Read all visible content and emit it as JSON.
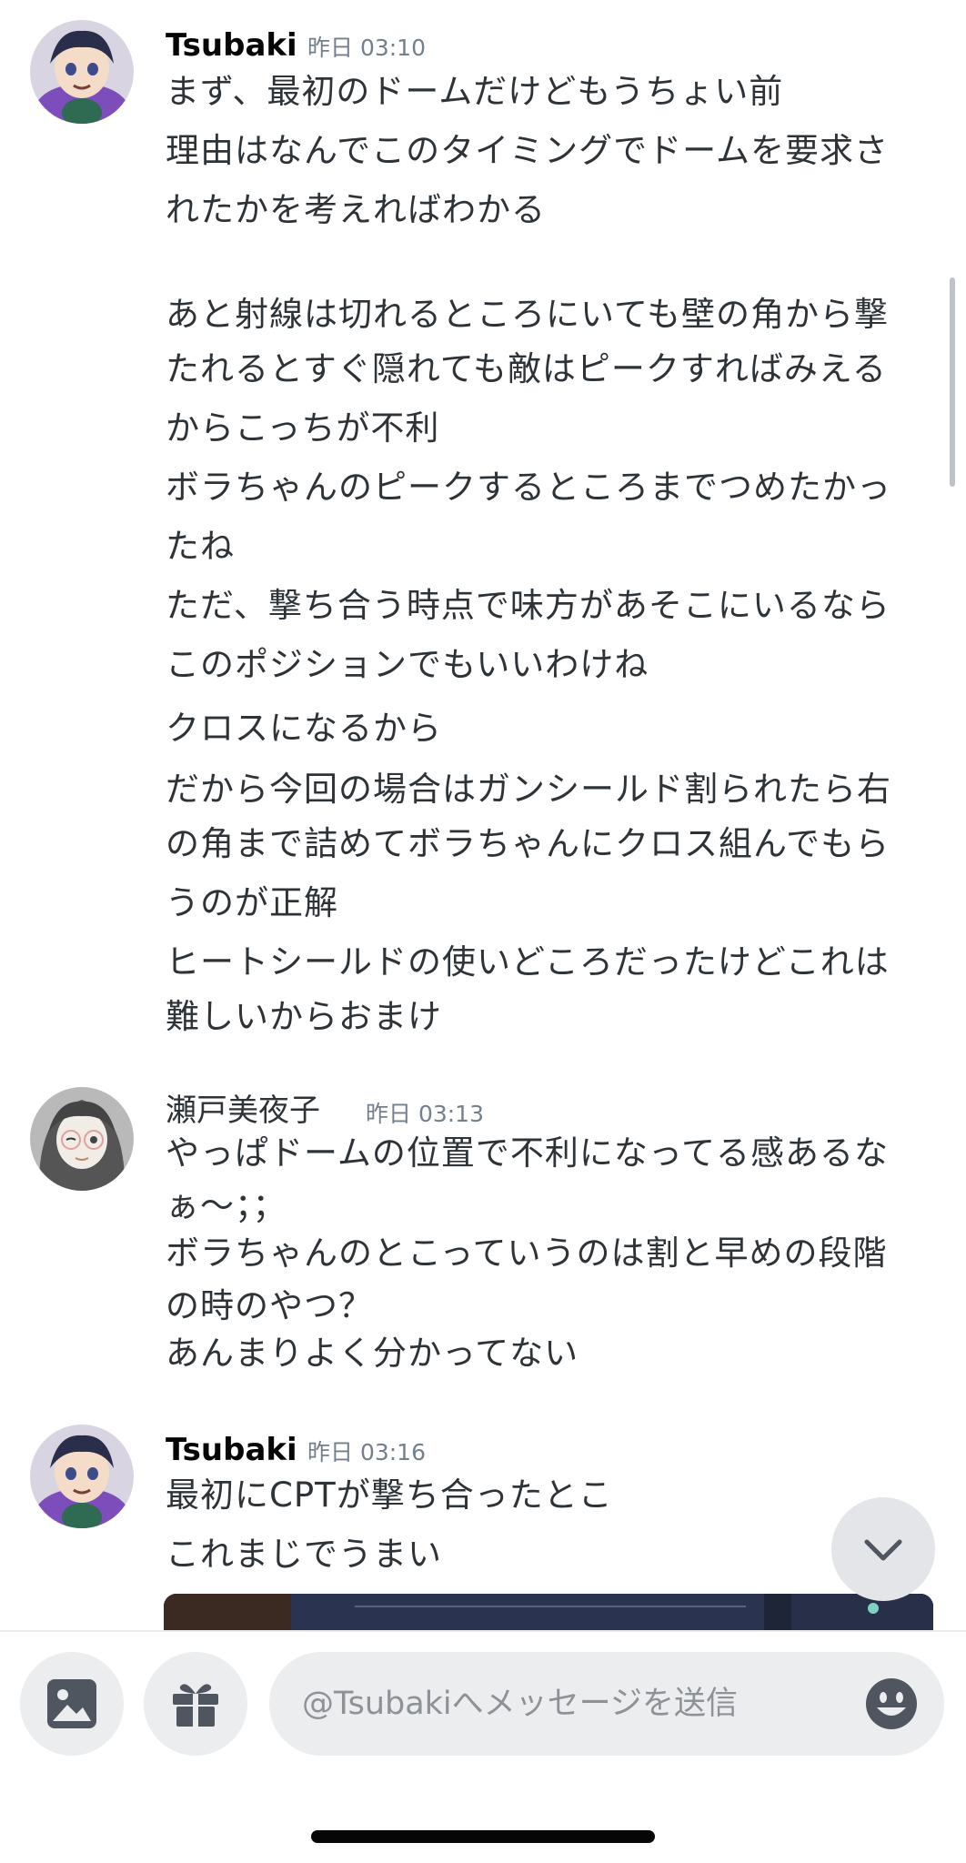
{
  "messages": [
    {
      "author": "Tsubaki",
      "timestamp": "昨日 03:10",
      "lines": [
        "まず、最初のドームだけどもうちょい前",
        "理由はなんでこのタイミングでドームを要求さ",
        "れたかを考えればわかる",
        "あと射線は切れるところにいても壁の角から撃",
        "たれるとすぐ隠れても敵はピークすればみえる",
        "からこっちが不利",
        "ボラちゃんのピークするところまでつめたかっ",
        "たね",
        "ただ、撃ち合う時点で味方があそこにいるなら",
        "このポジションでもいいわけね",
        "クロスになるから",
        "だから今回の場合はガンシールド割られたら右",
        "の角まで詰めてボラちゃんにクロス組んでもら",
        "うのが正解",
        "ヒートシールドの使いどころだったけどこれは",
        "難しいからおまけ"
      ]
    },
    {
      "author": "瀬戸美夜子",
      "timestamp": "昨日 03:13",
      "lines": [
        "やっぱドームの位置で不利になってる感あるな",
        "ぁ〜；；",
        "ボラちゃんのとこっていうのは割と早めの段階",
        "の時のやつ？",
        "あんまりよく分かってない"
      ]
    },
    {
      "author": "Tsubaki",
      "timestamp": "昨日 03:16",
      "lines": [
        "最初にCPTが撃ち合ったとこ",
        "これまじでうまい"
      ]
    }
  ],
  "composer": {
    "placeholder": "@Tsubakiへメッセージを送信"
  },
  "icons": {
    "image_button": "image-icon",
    "gift_button": "gift-icon",
    "emoji_button": "emoji-icon",
    "jump_button": "chevron-down-icon"
  },
  "colors": {
    "background": "#ffffff",
    "text": "#2e3338",
    "author": "#060607",
    "timestamp": "#747f8d",
    "button_bg": "#ebedef",
    "icon": "#4f5660"
  }
}
